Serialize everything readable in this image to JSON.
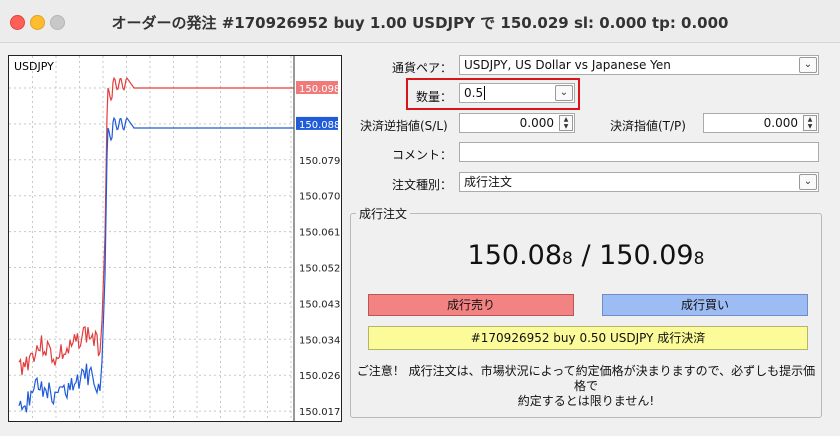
{
  "window": {
    "title": "オーダーの発注 #170926952 buy 1.00 USDJPY で 150.029 sl: 0.000 tp: 0.000"
  },
  "chart": {
    "symbol": "USDJPY",
    "price_labels": [
      "150.098",
      "150.088",
      "150.079",
      "150.070",
      "150.061",
      "150.052",
      "150.043",
      "150.034",
      "150.026",
      "150.017"
    ],
    "ask_label": "150.098",
    "bid_label": "150.088",
    "ask_color": "#e23c3c",
    "bid_color": "#1f5bd8",
    "ask_label_bg": "#f07a7a",
    "bid_label_bg": "#1f5bd8"
  },
  "form": {
    "symbol_label": "通貨ペア：",
    "symbol_value": "USDJPY, US Dollar vs Japanese Yen",
    "volume_label": "数量：",
    "volume_value": "0.5",
    "sl_label": "決済逆指値(S/L)",
    "sl_value": "0.000",
    "tp_label": "決済指値(T/P)",
    "tp_value": "0.000",
    "comment_label": "コメント：",
    "comment_value": "",
    "type_label": "注文種別：",
    "type_value": "成行注文"
  },
  "market": {
    "group_title": "成行注文",
    "bid_main": "150.08",
    "bid_tail": "8",
    "separator": " / ",
    "ask_main": "150.09",
    "ask_tail": "8",
    "sell_button": "成行売り",
    "buy_button": "成行買い",
    "close_button": "#170926952 buy 0.50 USDJPY 成行決済",
    "notice_line1": "ご注意！ 成行注文は、市場状況によって約定価格が決まりますので、必ずしも提示価格で",
    "notice_line2": "約定するとは限りません!"
  }
}
